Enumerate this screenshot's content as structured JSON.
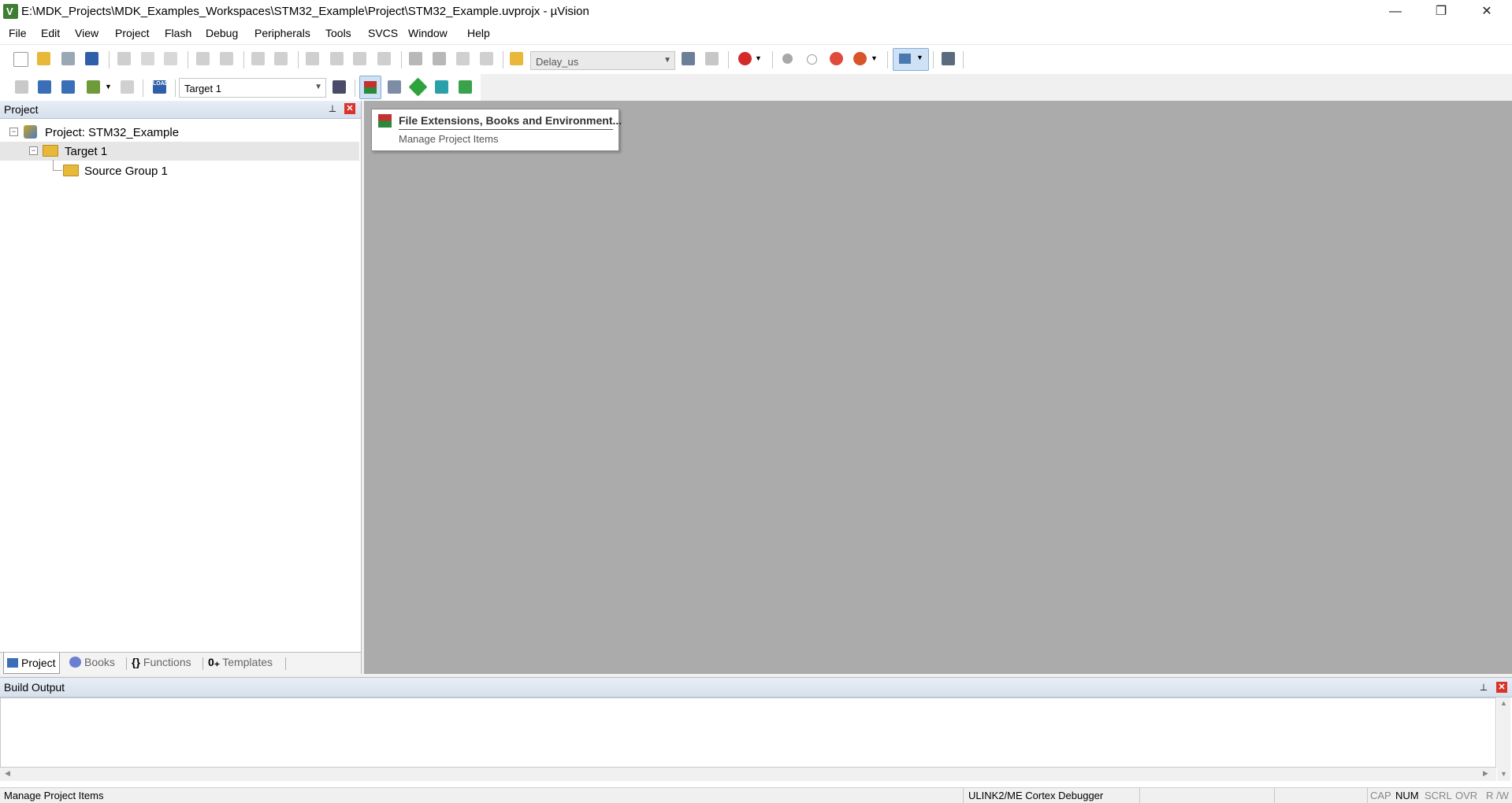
{
  "title_bar": {
    "title": "E:\\MDK_Projects\\MDK_Examples_Workspaces\\STM32_Example\\Project\\STM32_Example.uvprojx - µVision",
    "minimize": "—",
    "restore": "❐",
    "close": "✕"
  },
  "menu": [
    "File",
    "Edit",
    "View",
    "Project",
    "Flash",
    "Debug",
    "Peripherals",
    "Tools",
    "SVCS",
    "Window",
    "Help"
  ],
  "toolbar": {
    "find_combo_value": "Delay_us",
    "target_combo_value": "Target 1",
    "load_label": "LOAD"
  },
  "project_panel": {
    "title": "Project",
    "tree": {
      "root": "Project: STM32_Example",
      "target": "Target 1",
      "group": "Source Group 1"
    },
    "tabs": [
      "Project",
      "Books",
      "Functions",
      "Templates"
    ]
  },
  "context_menu": {
    "item1": "File Extensions, Books and Environment...",
    "item2": "Manage Project Items"
  },
  "build_output": {
    "title": "Build Output"
  },
  "status_bar": {
    "message": "Manage Project Items",
    "debugger": "ULINK2/ME Cortex Debugger",
    "cap": "CAP",
    "num": "NUM",
    "scrl": "SCRL",
    "ovr": "OVR",
    "rw": "R /W"
  },
  "colors": {
    "main_area_bg": "#ababab",
    "panel_header": "#dbe4ef",
    "close_red": "#d9342b"
  }
}
